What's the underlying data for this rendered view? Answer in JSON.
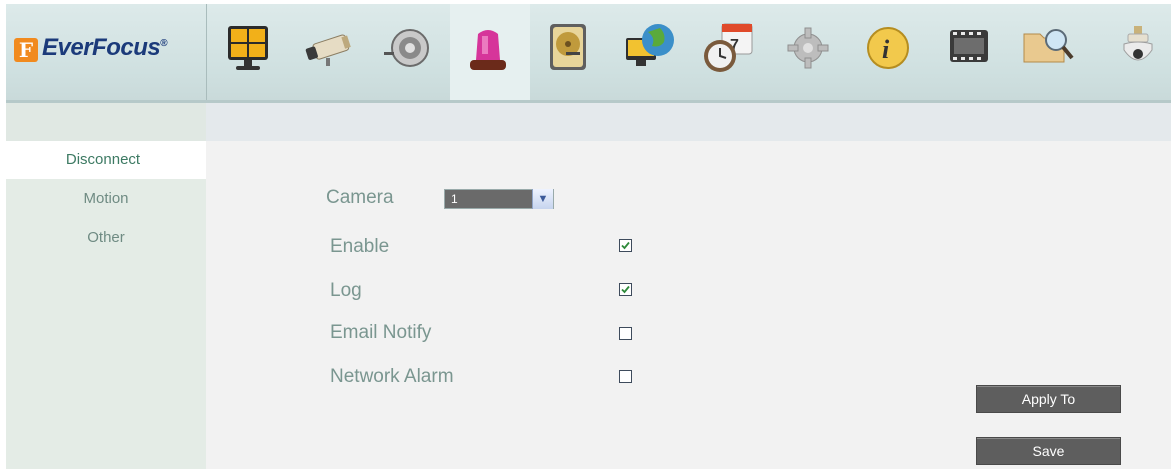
{
  "brand": {
    "badge": "F",
    "name": "EverFocus",
    "reg": "®"
  },
  "toolbar": {
    "items": [
      {
        "icon": "live-view-icon"
      },
      {
        "icon": "camera-icon"
      },
      {
        "icon": "record-icon"
      },
      {
        "icon": "alarm-siren-icon",
        "active": true
      },
      {
        "icon": "hard-disk-icon"
      },
      {
        "icon": "network-icon"
      },
      {
        "icon": "schedule-icon"
      },
      {
        "icon": "settings-gear-icon"
      },
      {
        "icon": "info-icon"
      },
      {
        "icon": "playback-film-icon"
      },
      {
        "icon": "search-folder-icon"
      },
      {
        "icon": "ptz-dome-icon"
      }
    ]
  },
  "sidebar": {
    "items": [
      {
        "label": "Disconnect",
        "active": true
      },
      {
        "label": "Motion"
      },
      {
        "label": "Other"
      }
    ]
  },
  "form": {
    "camera_label": "Camera",
    "camera_value": "1",
    "enable_label": "Enable",
    "enable_checked": true,
    "log_label": "Log",
    "log_checked": true,
    "email_label": "Email Notify",
    "email_checked": false,
    "network_label": "Network Alarm",
    "network_checked": false
  },
  "buttons": {
    "apply_to": "Apply To",
    "save": "Save"
  },
  "colors": {
    "accent": "#3d7a63",
    "label": "#7a9690",
    "logo": "#1b3a7a",
    "logo_badge": "#f18a1e"
  }
}
